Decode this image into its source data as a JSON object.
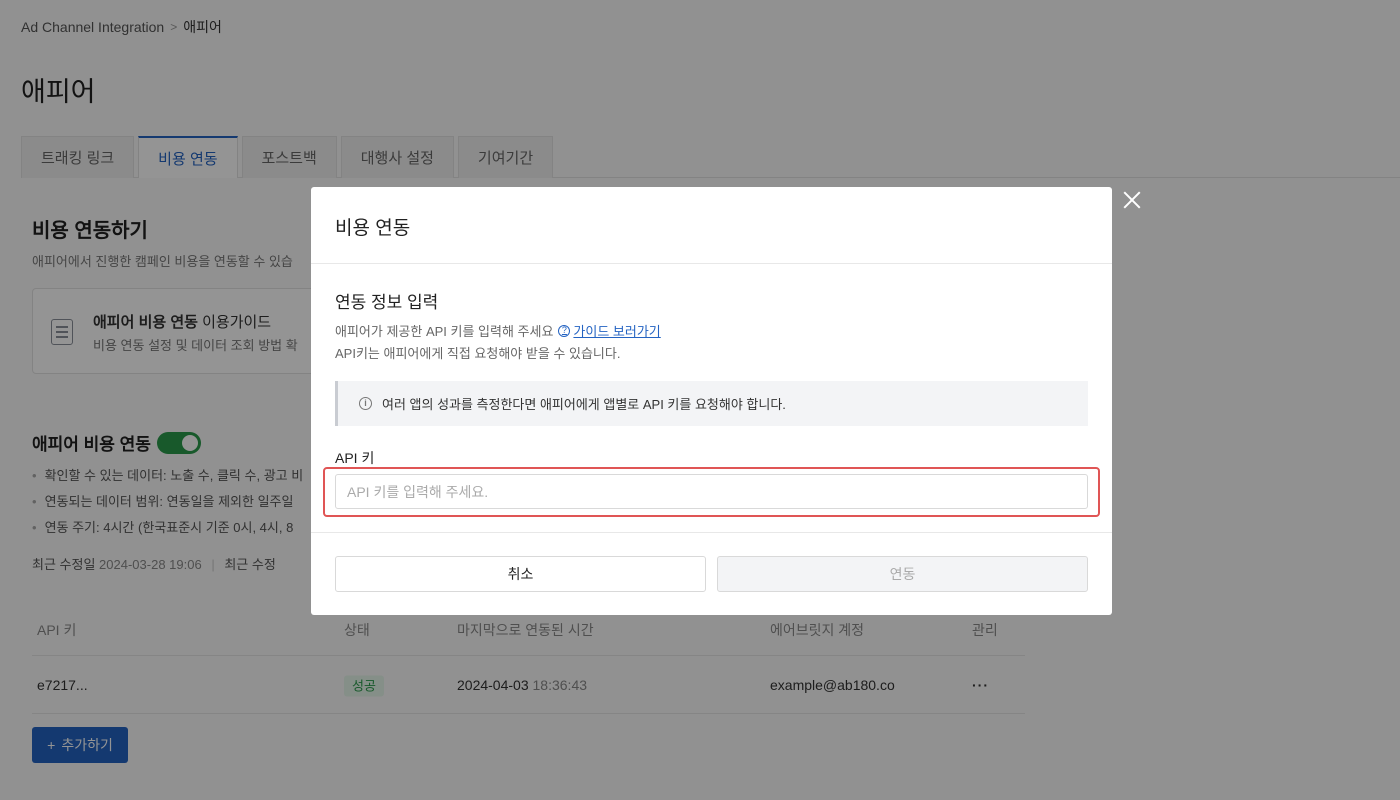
{
  "breadcrumb": {
    "root": "Ad Channel Integration",
    "separator": ">",
    "current": "애피어"
  },
  "page": {
    "title": "애피어"
  },
  "tabs": [
    {
      "label": "트래킹 링크"
    },
    {
      "label": "비용 연동"
    },
    {
      "label": "포스트백"
    },
    {
      "label": "대행사 설정"
    },
    {
      "label": "기여기간"
    }
  ],
  "section": {
    "title": "비용 연동하기",
    "desc": "애피어에서 진행한 캠페인 비용을 연동할 수 있습"
  },
  "guide": {
    "title_bold": "애피어 비용 연동",
    "title_rest": " 이용가이드",
    "desc": "비용 연동 설정 및 데이터 조회 방법 확"
  },
  "sync": {
    "title": "애피어 비용 연동",
    "bullets": [
      "확인할 수 있는 데이터: 노출 수, 클릭 수, 광고 비",
      "연동되는 데이터 범위: 연동일을 제외한 일주일",
      "연동 주기: 4시간 (한국표준시 기준 0시, 4시, 8"
    ],
    "modified_label": "최근 수정일",
    "modified_value": "2024-03-28 19:06",
    "modified_label2": "최근 수정"
  },
  "table": {
    "headers": [
      "API 키",
      "상태",
      "마지막으로 연동된 시간",
      "에어브릿지 계정",
      "관리"
    ],
    "rows": [
      {
        "api_key": "e7217...",
        "status": "성공",
        "date": "2024-04-03",
        "time": "18:36:43",
        "account": "example@ab180.co",
        "menu": "···"
      }
    ]
  },
  "add_button": {
    "icon": "+",
    "label": "추가하기"
  },
  "modal": {
    "title": "비용 연동",
    "body_title": "연동 정보 입력",
    "desc1": "애피어가 제공한 API 키를 입력해 주세요",
    "guide_link_icon": "?",
    "guide_link": "가이드 보러가기",
    "desc2": "API키는 애피어에게 직접 요청해야 받을 수 있습니다.",
    "notice_icon": "i",
    "notice": "여러 앱의 성과를 측정한다면 애피어에게 앱별로 API 키를 요청해야 합니다.",
    "api_label": "API 키",
    "api_placeholder": "API 키를 입력해 주세요.",
    "api_value": "",
    "cancel": "취소",
    "confirm": "연동"
  },
  "colors": {
    "accent": "#2463c2",
    "success": "#2a9a4b",
    "highlight": "#e05555"
  }
}
